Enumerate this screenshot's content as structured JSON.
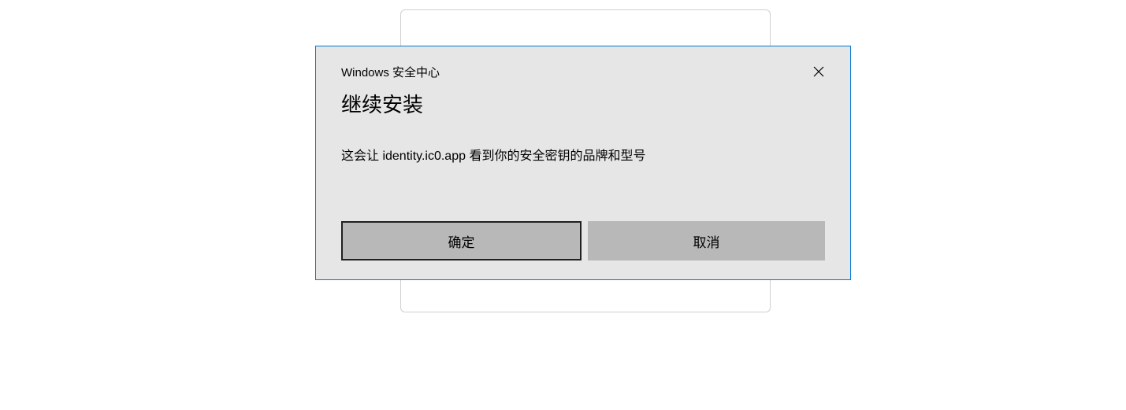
{
  "dialog": {
    "source": "Windows 安全中心",
    "title": "继续安装",
    "message": "这会让 identity.ic0.app 看到你的安全密钥的品牌和型号",
    "ok_label": "确定",
    "cancel_label": "取消"
  }
}
